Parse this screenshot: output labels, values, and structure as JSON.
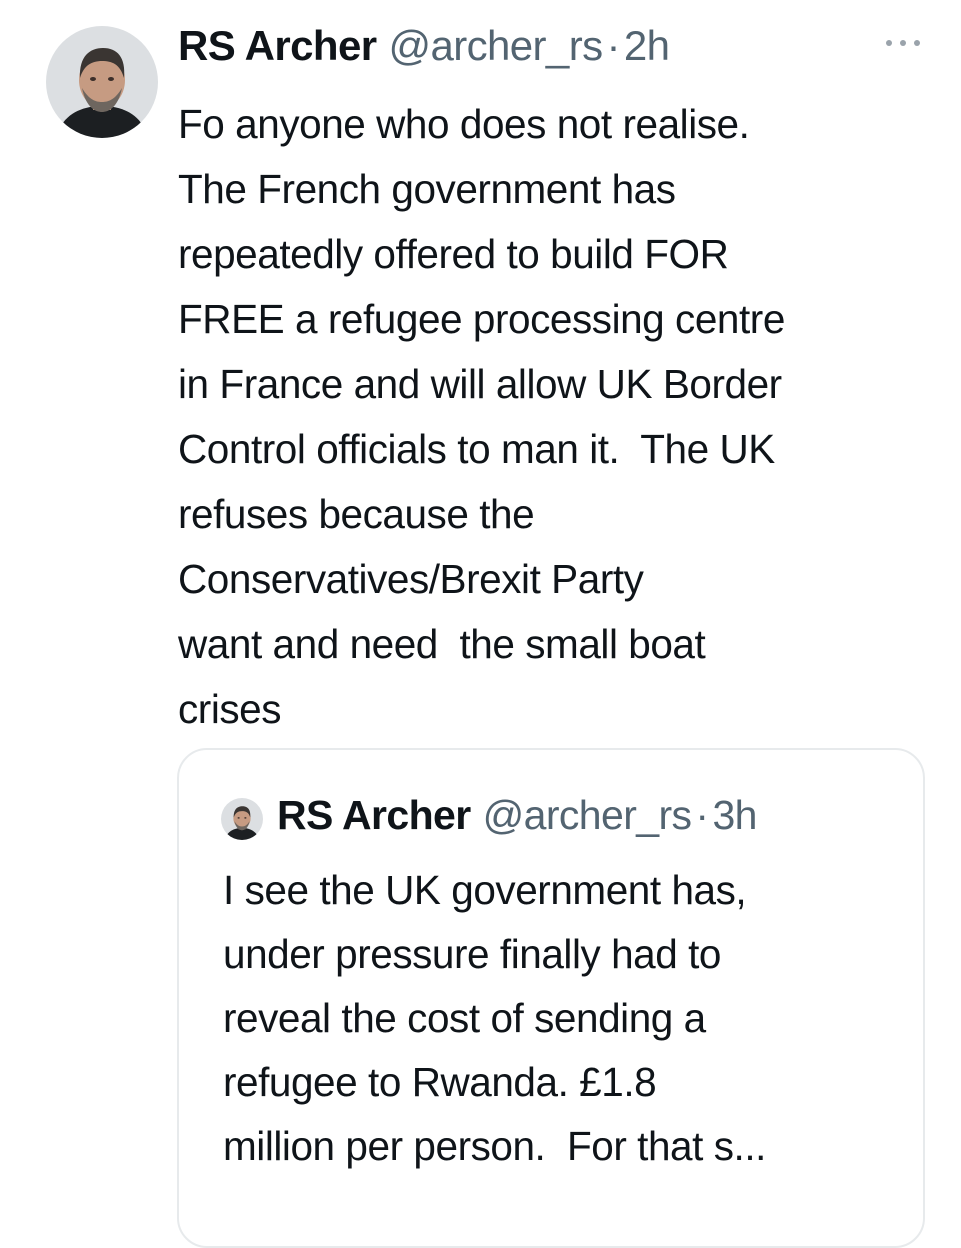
{
  "tweet": {
    "author_name": "RS Archer",
    "handle": "@archer_rs",
    "separator": "·",
    "time": "2h",
    "avatar": "user-avatar-photo",
    "more_icon": "more-horizontal-icon",
    "text": "Fo anyone who does not realise.\nThe French government has\nrepeatedly offered to build FOR\nFREE a refugee processing centre\nin France and will allow UK Border\nControl officials to man it.  The UK\nrefuses because the\nConservatives/Brexit Party\nwant and need  the small boat\ncrises"
  },
  "quoted_tweet": {
    "author_name": "RS Archer",
    "handle": "@archer_rs",
    "separator": "·",
    "time": "3h",
    "avatar": "user-avatar-photo",
    "text": "I see the UK government has,\nunder pressure finally had to\nreveal the cost of sending a\nrefugee to Rwanda. £1.8\nmillion per person.  For that s..."
  },
  "colors": {
    "text": "#0f1419",
    "secondary": "#536471",
    "border": "#e7eaec"
  }
}
